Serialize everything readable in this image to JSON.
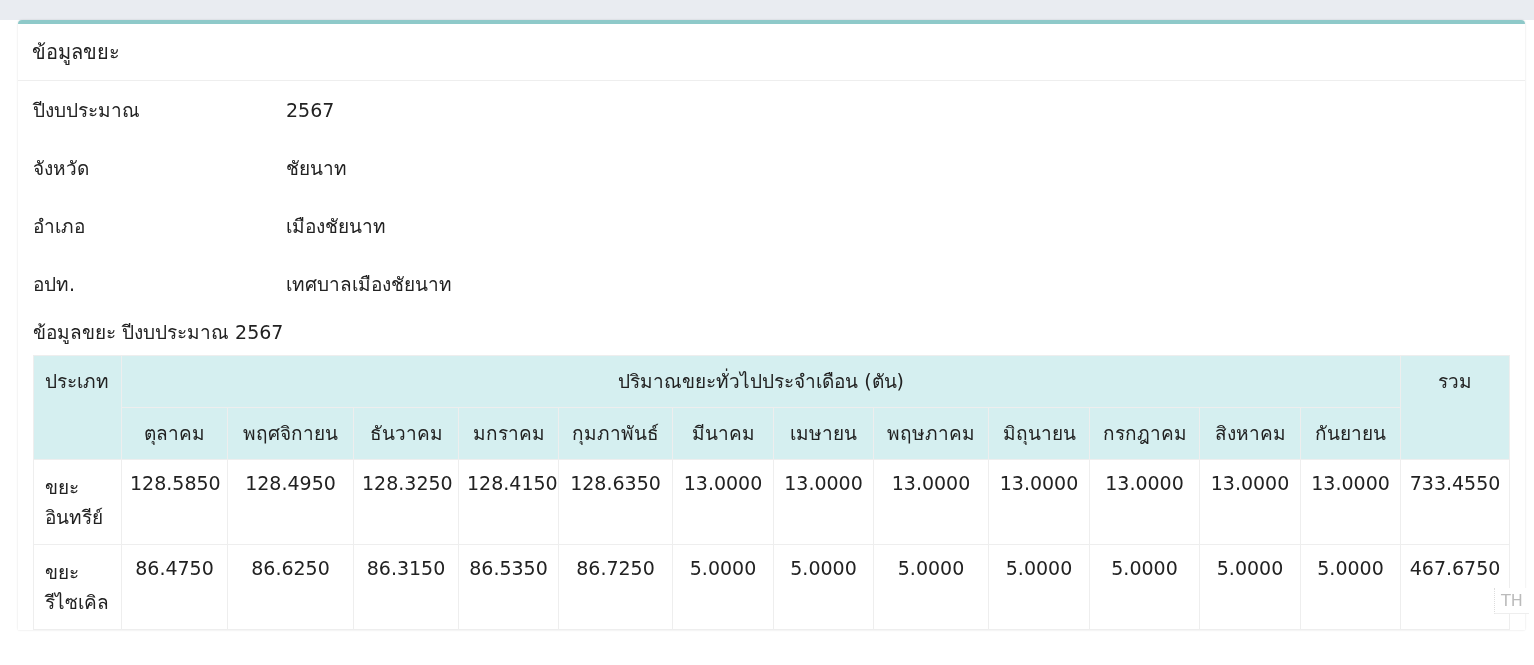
{
  "card": {
    "title": "ข้อมูลขยะ"
  },
  "info": [
    {
      "label": "ปีงบประมาณ",
      "value": "2567"
    },
    {
      "label": "จังหวัด",
      "value": "ชัยนาท"
    },
    {
      "label": "อำเภอ",
      "value": "เมืองชัยนาท"
    },
    {
      "label": "อปท.",
      "value": "เทศบาลเมืองชัยนาท"
    }
  ],
  "table": {
    "caption": "ข้อมูลขยะ ปีงบประมาณ 2567",
    "type_header": "ประเภท",
    "group_header": "ปริมาณขยะทั่วไปประจำเดือน (ตัน)",
    "total_header": "รวม",
    "months": [
      "ตุลาคม",
      "พฤศจิกายน",
      "ธันวาคม",
      "มกราคม",
      "กุมภาพันธ์",
      "มีนาคม",
      "เมษายน",
      "พฤษภาคม",
      "มิถุนายน",
      "กรกฎาคม",
      "สิงหาคม",
      "กันยายน"
    ],
    "rows": [
      {
        "type": "ขยะ อินทรีย์",
        "values": [
          "128.5850",
          "128.4950",
          "128.3250",
          "128.4150",
          "128.6350",
          "13.0000",
          "13.0000",
          "13.0000",
          "13.0000",
          "13.0000",
          "13.0000",
          "13.0000"
        ],
        "total": "733.4550"
      },
      {
        "type": "ขยะ รีไซเคิล",
        "values": [
          "86.4750",
          "86.6250",
          "86.3150",
          "86.5350",
          "86.7250",
          "5.0000",
          "5.0000",
          "5.0000",
          "5.0000",
          "5.0000",
          "5.0000",
          "5.0000"
        ],
        "total": "467.6750"
      }
    ]
  },
  "language_badge": "TH"
}
